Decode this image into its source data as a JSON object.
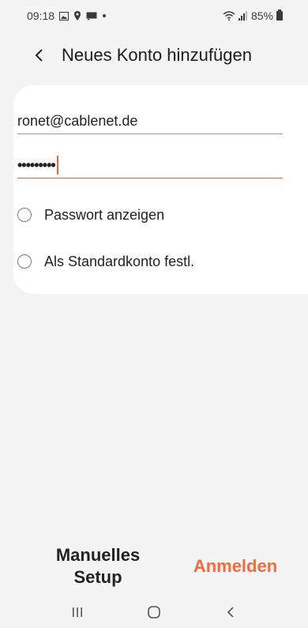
{
  "status_bar": {
    "time": "09:18",
    "battery": "85%",
    "icons": [
      "gallery-icon",
      "location-icon",
      "message-icon",
      "dot-icon",
      "wifi-icon",
      "signal-icon",
      "battery-icon"
    ]
  },
  "header": {
    "back_icon": "back-chevron-icon",
    "title": "Neues Konto hinzufügen"
  },
  "form": {
    "email_value": "ronet@cablenet.de",
    "password_masked": "•••••••••",
    "show_password_label": "Passwort anzeigen",
    "default_account_label": "Als Standardkonto festl."
  },
  "actions": {
    "manual_setup_line1": "Manuelles",
    "manual_setup_line2": "Setup",
    "login_label": "Anmelden"
  },
  "colors": {
    "accent": "#f26a3d",
    "background": "#f4f4f4",
    "card": "#ffffff"
  },
  "navigation": {
    "buttons": [
      "recent-apps-icon",
      "home-icon",
      "back-icon"
    ]
  }
}
